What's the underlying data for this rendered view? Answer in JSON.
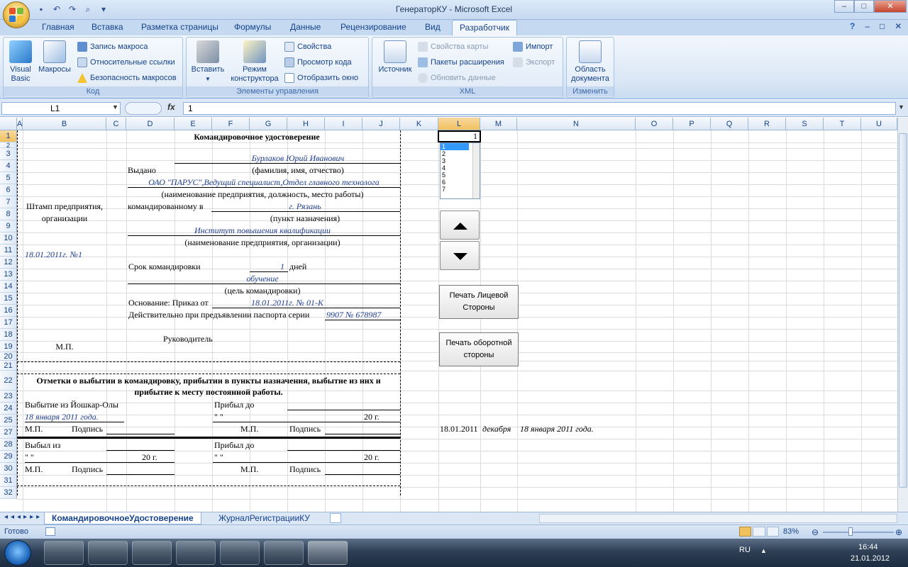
{
  "window": {
    "title": "ГенераторКУ - Microsoft Excel",
    "controls": [
      "–",
      "□",
      "✕"
    ],
    "ribbon_controls": [
      "?",
      "–",
      "□",
      "✕"
    ]
  },
  "tabs": [
    "Главная",
    "Вставка",
    "Разметка страницы",
    "Формулы",
    "Данные",
    "Рецензирование",
    "Вид",
    "Разработчик"
  ],
  "ribbon": {
    "code": {
      "label": "Код",
      "visual_basic": "Visual Basic",
      "macros": "Макросы",
      "record_macro": "Запись макроса",
      "relative_refs": "Относительные ссылки",
      "macro_security": "Безопасность макросов"
    },
    "controls": {
      "label": "Элементы управления",
      "insert": "Вставить",
      "design_mode": "Режим конструктора",
      "properties": "Свойства",
      "view_code": "Просмотр кода",
      "show_dialog": "Отобразить окно"
    },
    "xml": {
      "label": "XML",
      "source": "Источник",
      "map_props": "Свойства карты",
      "expansion_packs": "Пакеты расширения",
      "refresh_data": "Обновить данные",
      "import": "Импорт",
      "export": "Экспорт"
    },
    "modify": {
      "label": "Изменить",
      "doc_panel": "Область документа"
    }
  },
  "formula_bar": {
    "name_box": "L1",
    "fx": "fx",
    "value": "1"
  },
  "columns": [
    "A",
    "B",
    "C",
    "D",
    "E",
    "F",
    "G",
    "H",
    "I",
    "J",
    "K",
    "L",
    "M",
    "N",
    "O",
    "P",
    "Q",
    "R",
    "S",
    "T",
    "U"
  ],
  "rows": [
    "1",
    "2",
    "3",
    "4",
    "5",
    "6",
    "7",
    "8",
    "9",
    "10",
    "11",
    "12",
    "13",
    "14",
    "15",
    "16",
    "17",
    "18",
    "19",
    "20",
    "21",
    "22",
    "23",
    "24",
    "25",
    "27",
    "28",
    "29",
    "30",
    "31",
    "32"
  ],
  "form": {
    "title": "Командировочное удостоверение",
    "stamp": "Штамп предприятия, организации",
    "stamp_line1": "Штамп предприятия,",
    "stamp_line2": "организации",
    "issued_label": "Выдано",
    "person": "Бурлаков Юрий Иванович",
    "person_caption": "(фамилия, имя, отчество)",
    "org_position": "ОАО \"ПАРУС\",Ведущий специалист,Отдел главного технолога",
    "org_caption": "(наименование предприятия, должность, место работы)",
    "sent_label": "командированному в",
    "destination": "г. Рязань",
    "destination_caption": "(пункт назначения)",
    "dest_org": "Институт повышения квалификации",
    "dest_org_caption": "(наименование предприятия, организации)",
    "doc_number": "18.01.2011г. №1",
    "term_label": "Срок командировки",
    "term_value": "1",
    "term_unit": "дней",
    "purpose": "обучение",
    "purpose_caption": "(цель командировки)",
    "basis_label": "Основание: Приказ от",
    "basis_value": "18.01.2011г. № 01-К",
    "passport_label": "Действительно при предъявлении паспорта серии",
    "passport_value": "9907 № 678987",
    "head_label": "Руководитель",
    "seal": "М.П.",
    "marks_title1": "Отметки о выбытии в командировку, прибытии в пункты назначения, выбытие из них и",
    "marks_title2": "прибытие к месту постоянной работы.",
    "departure_label": "Выбытие из Йошкар-Олы",
    "departure_date": "18 января 2011 года.",
    "arrived_label": "Прибыл до",
    "quote_pair": "\"        \"",
    "year_suffix": "20   г.",
    "sign_label": "Подпись",
    "left_from_label": "Выбыл из"
  },
  "side": {
    "l1_value": "1",
    "list_items": [
      "1",
      "2",
      "3",
      "4",
      "5",
      "6",
      "7"
    ],
    "print_front": "Печать Лицевой Стороны",
    "print_back": "Печать оборотной стороны",
    "row25_date": "18.01.2011",
    "row25_month": "декабря",
    "row25_text": "18 января 2011 года."
  },
  "sheets": [
    "КомандировочноеУдостоверение",
    "ЖурналРегистрацииКУ"
  ],
  "status": {
    "ready": "Готово",
    "zoom": "83%"
  },
  "taskbar": {
    "lang": "RU",
    "time": "16:44",
    "date": "21.01.2012"
  },
  "colors": {
    "ribbon_bg": "#dbe7f5",
    "tab_text": "#15428b",
    "sel_header": "#f1c15f",
    "taskbar": "#2e3f55"
  }
}
